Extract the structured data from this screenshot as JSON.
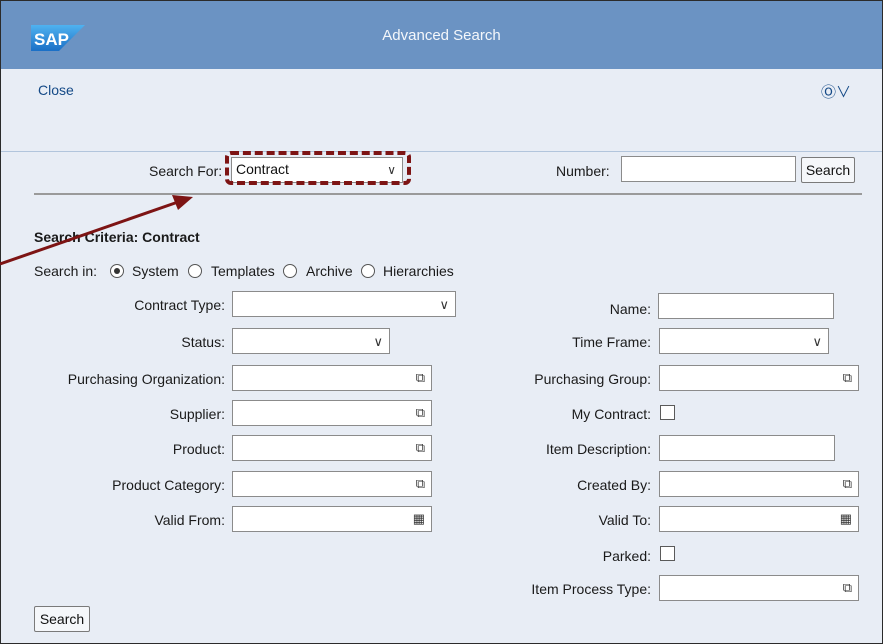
{
  "header": {
    "logo": "SAP",
    "title": "Advanced Search"
  },
  "toolbar": {
    "close_label": "Close",
    "help_icon": "help-icon"
  },
  "top": {
    "search_for_label": "Search For:",
    "search_for_value": "Contract",
    "number_label": "Number:",
    "number_value": "",
    "search_label": "Search"
  },
  "criteria": {
    "heading": "Search Criteria: Contract",
    "search_in_label": "Search in:",
    "options": [
      "System",
      "Templates",
      "Archive",
      "Hierarchies"
    ],
    "selected": "System"
  },
  "left": {
    "contract_type": "Contract Type:",
    "status": "Status:",
    "purch_org": "Purchasing Organization:",
    "supplier": "Supplier:",
    "product": "Product:",
    "product_category": "Product Category:",
    "valid_from": "Valid From:"
  },
  "right": {
    "name": "Name:",
    "time_frame": "Time Frame:",
    "purch_group": "Purchasing Group:",
    "my_contract": "My Contract:",
    "item_description": "Item Description:",
    "created_by": "Created By:",
    "valid_to": "Valid To:",
    "parked": "Parked:",
    "item_process_type": "Item Process Type:"
  },
  "bottom": {
    "search_label": "Search"
  },
  "colors": {
    "header": "#6b93c3",
    "body": "#e8edf5",
    "highlight": "#7d1414",
    "link": "#154a87"
  }
}
